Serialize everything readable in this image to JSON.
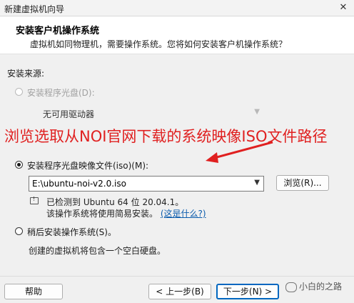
{
  "window": {
    "title": "新建虚拟机向导",
    "close_glyph": "✕"
  },
  "header": {
    "title": "安装客户机操作系统",
    "description": "虚拟机如同物理机，需要操作系统。您将如何安装客户机操作系统？"
  },
  "install_source": {
    "label": "安装来源:",
    "disc_option": {
      "label": "安装程序光盘(D):",
      "enabled": false,
      "selected": false
    },
    "disc_drive": {
      "value": "无可用驱动器"
    },
    "iso_option": {
      "label": "安装程序光盘映像文件(iso)(M):",
      "enabled": true,
      "selected": true
    },
    "iso_path": {
      "value": "E:\\ubuntu-noi-v2.0.iso"
    },
    "browse_label": "浏览(R)...",
    "detected_text": "已检测到 Ubuntu 64 位 20.04.1。",
    "easy_install_text": "该操作系统将使用简易安装。",
    "what_is_this_link": "(这是什么?)",
    "later_option": {
      "label": "稍后安装操作系统(S)。",
      "selected": false
    },
    "later_desc": "创建的虚拟机将包含一个空白硬盘。"
  },
  "annotation": {
    "text": "浏览选取从NOI官网下载的系统映像ISO文件路径",
    "color": "#e02020"
  },
  "footer": {
    "help_label": "帮助",
    "back_label": "< 上一步(B)",
    "next_label": "下一步(N) >",
    "watermark": "小白的之路"
  },
  "colors": {
    "accent": "#0067c0",
    "link": "#0b5cad",
    "annotation": "#e02020"
  }
}
